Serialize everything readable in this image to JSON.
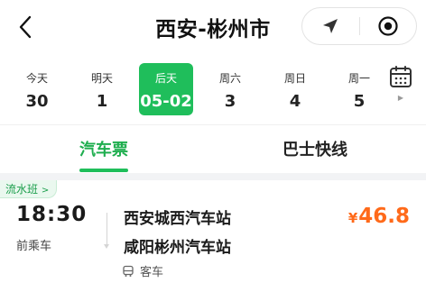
{
  "header": {
    "title": "西安-彬州市",
    "back_icon": "chevron-left-icon",
    "actions": [
      "location-arrow-icon",
      "target-icon"
    ]
  },
  "dates": [
    {
      "weekday": "今天",
      "day": "30",
      "active": false
    },
    {
      "weekday": "明天",
      "day": "1",
      "active": false
    },
    {
      "weekday": "后天",
      "day": "05-02",
      "active": true
    },
    {
      "weekday": "周六",
      "day": "3",
      "active": false
    },
    {
      "weekday": "周日",
      "day": "4",
      "active": false
    },
    {
      "weekday": "周一",
      "day": "5",
      "active": false
    }
  ],
  "calendar_icon": "calendar-icon",
  "tabs": [
    {
      "label": "汽车票",
      "active": true
    },
    {
      "label": "巴士快线",
      "active": false
    }
  ],
  "trip": {
    "badge": "流水班",
    "time": "18:30",
    "time_note": "前乘车",
    "from": "西安城西汽车站",
    "to": "咸阳彬州汽车站",
    "vehicle": "客车",
    "currency": "¥",
    "price": "46.8"
  },
  "colors": {
    "accent": "#1fbe5b",
    "price": "#ff6a1a",
    "background": "#f2f3f5"
  }
}
